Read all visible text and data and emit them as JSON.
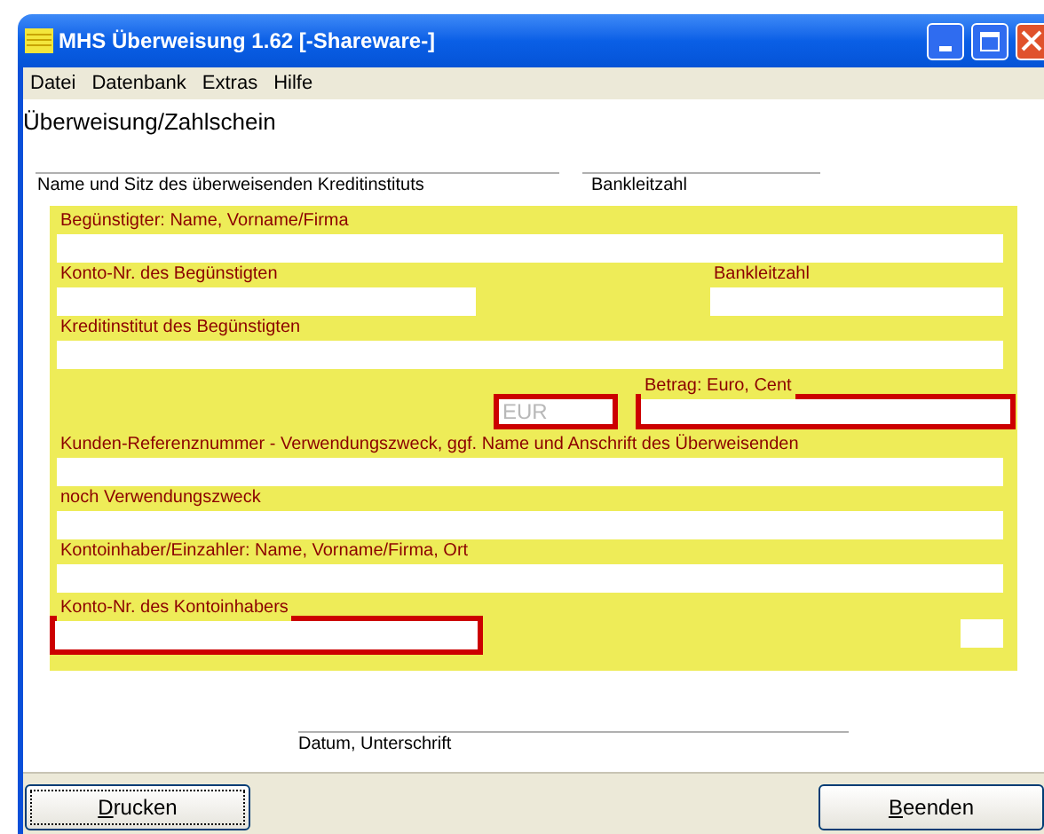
{
  "window": {
    "title": "MHS Überweisung 1.62 [-Shareware-]"
  },
  "menu": [
    "Datei",
    "Datenbank",
    "Extras",
    "Hilfe"
  ],
  "heading": "Überweisung/Zahlschein",
  "header_lines": [
    {
      "label": "Name und Sitz des überweisenden Kreditinstituts"
    },
    {
      "label": "Bankleitzahl"
    }
  ],
  "form": {
    "beneficiary": {
      "label": "Begünstigter: Name, Vorname/Firma",
      "highlighted": false
    },
    "beneficiary_account": {
      "label": "Konto-Nr. des Begünstigten",
      "highlighted": false
    },
    "beneficiary_bank_code": {
      "label": "Bankleitzahl",
      "highlighted": false
    },
    "beneficiary_bank": {
      "label": "Kreditinstitut des Begünstigten",
      "highlighted": false
    },
    "currency": {
      "placeholder": "EUR",
      "highlighted": true
    },
    "amount": {
      "label": "Betrag: Euro, Cent",
      "highlighted": true
    },
    "reference": {
      "label": "Kunden-Referenznummer - Verwendungszweck, ggf. Name und Anschrift des Überweisenden",
      "highlighted": false
    },
    "purpose_2": {
      "label": "noch Verwendungszweck",
      "highlighted": false
    },
    "payer": {
      "label": "Kontoinhaber/Einzahler: Name, Vorname/Firma, Ort",
      "highlighted": false
    },
    "payer_account": {
      "label": "Konto-Nr. des Kontoinhabers",
      "highlighted": true
    },
    "extra_field": {
      "highlighted": false
    }
  },
  "signature": {
    "label": "Datum, Unterschrift"
  },
  "buttons": [
    {
      "label": "Drucken",
      "focused": true
    },
    {
      "label": "Beenden",
      "focused": false
    }
  ]
}
